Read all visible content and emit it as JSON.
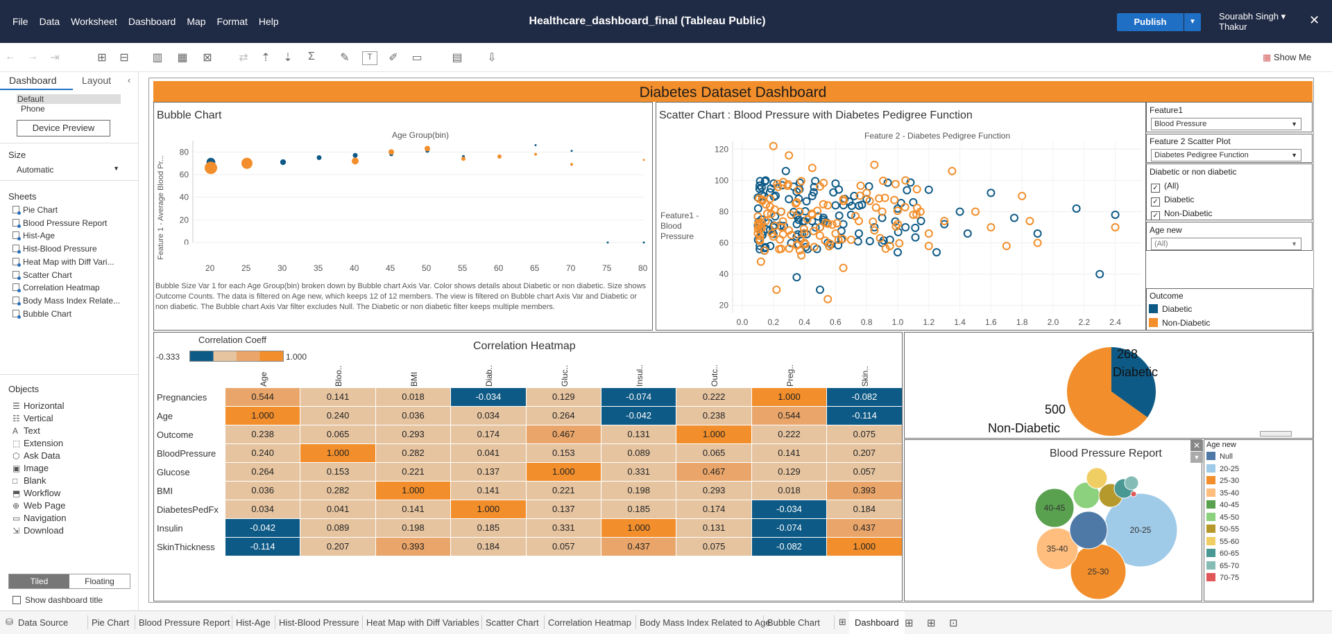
{
  "menu": [
    "File",
    "Data",
    "Worksheet",
    "Dashboard",
    "Map",
    "Format",
    "Help"
  ],
  "app_title": "Healthcare_dashboard_final (Tableau Public)",
  "publish_label": "Publish",
  "user_name_1": "Sourabh Singh",
  "user_name_2": "Thakur",
  "show_me": "Show Me",
  "left": {
    "tabs": [
      "Dashboard",
      "Layout"
    ],
    "device_default": "Default",
    "device_phone": "Phone",
    "device_preview": "Device Preview",
    "size_label": "Size",
    "size_value": "Automatic",
    "sheets_label": "Sheets",
    "sheets": [
      "Pie Chart",
      "Blood Pressure Report",
      "Hist-Age",
      "Hist-Blood Pressure",
      "Heat Map with Diff Vari...",
      "Scatter Chart",
      "Correlation Heatmap",
      "Body Mass Index Relate...",
      "Bubble Chart"
    ],
    "objects_label": "Objects",
    "objects": [
      {
        "label": "Horizontal",
        "icon": "horizontal-container-icon"
      },
      {
        "label": "Vertical",
        "icon": "vertical-container-icon"
      },
      {
        "label": "Text",
        "icon": "text-icon"
      },
      {
        "label": "Extension",
        "icon": "extension-icon"
      },
      {
        "label": "Ask Data",
        "icon": "ask-data-icon"
      },
      {
        "label": "Image",
        "icon": "image-icon"
      },
      {
        "label": "Blank",
        "icon": "blank-icon"
      },
      {
        "label": "Workflow",
        "icon": "workflow-icon"
      },
      {
        "label": "Web Page",
        "icon": "web-page-icon"
      },
      {
        "label": "Navigation",
        "icon": "navigation-icon"
      },
      {
        "label": "Download",
        "icon": "download-icon"
      }
    ],
    "tiled": "Tiled",
    "floating": "Floating",
    "show_title": "Show dashboard title"
  },
  "bottom_tabs": [
    "Data Source",
    "Pie Chart",
    "Blood Pressure Report",
    "Hist-Age",
    "Hist-Blood Pressure",
    "Heat Map with Diff Variables",
    "Scatter Chart",
    "Correlation Heatmap",
    "Body Mass Index Related to Age",
    "Bubble Chart",
    "Dashboard"
  ],
  "dashboard_title": "Diabetes Dataset Dashboard",
  "colors": {
    "diabetic": "#0e5a86",
    "non_diabetic": "#f28e2b"
  },
  "bubble": {
    "title": "Bubble Chart",
    "x_header": "Age Group(bin)",
    "y_title": "Feature 1 - Average Blood Pr...",
    "y_ticks": [
      "80",
      "60",
      "40",
      "20",
      "0"
    ],
    "x_ticks": [
      "20",
      "25",
      "30",
      "35",
      "40",
      "45",
      "50",
      "55",
      "60",
      "65",
      "70",
      "75",
      "80"
    ],
    "caption": "Bubble Size Var 1 for each Age Group(bin) broken down by Bubble chart Axis Var.  Color shows details about Diabetic or non diabetic.  Size shows Outcome Counts. The data is filtered on Age new, which keeps 12 of 12 members. The view is filtered on Bubble chart Axis Var and Diabetic or non diabetic. The Bubble chart Axis Var filter excludes Null. The Diabetic or non diabetic filter keeps multiple members."
  },
  "scatter": {
    "title": "Scatter Chart : Blood Pressure  with Diabetes Pedigree Function",
    "x_header": "Feature 2 - Diabetes Pedigree Function",
    "y_title_1": "Feature1 -",
    "y_title_2": "Blood",
    "y_title_3": "Pressure",
    "y_ticks": [
      "120",
      "100",
      "80",
      "60",
      "40",
      "20"
    ],
    "x_ticks": [
      "0.0",
      "0.2",
      "0.4",
      "0.6",
      "0.8",
      "1.0",
      "1.2",
      "1.4",
      "1.6",
      "1.8",
      "2.0",
      "2.2",
      "2.4"
    ]
  },
  "filters": {
    "f1_label": "Feature1",
    "f1_value": "Blood Pressure",
    "f2_label": "Feature 2 Scatter Plot",
    "f2_value": "Diabetes Pedigree Function",
    "dn_label": "Diabetic or non diabetic",
    "dn_options": [
      "(All)",
      "Diabetic",
      "Non-Diabetic"
    ],
    "age_label": "Age new",
    "age_value": "(All)",
    "outcome_label": "Outcome",
    "outcome_items": [
      "Diabetic",
      "Non-Diabetic"
    ]
  },
  "heatmap": {
    "title": "Correlation Heatmap",
    "legend_title": "Correlation Coeff",
    "legend_min": "-0.333",
    "legend_max": "1.000",
    "columns": [
      "Age",
      "Bloo..",
      "BMI",
      "Diab..",
      "Gluc..",
      "Insul..",
      "Outc..",
      "Preg..",
      "Skin.."
    ],
    "rows": [
      "Pregnancies",
      "Age",
      "Outcome",
      "BloodPressure",
      "Glucose",
      "BMI",
      "DiabetesPedFx",
      "Insulin",
      "SkinThickness"
    ],
    "values": [
      [
        "0.544",
        "0.141",
        "0.018",
        "-0.034",
        "0.129",
        "-0.074",
        "0.222",
        "1.000",
        "-0.082"
      ],
      [
        "1.000",
        "0.240",
        "0.036",
        "0.034",
        "0.264",
        "-0.042",
        "0.238",
        "0.544",
        "-0.114"
      ],
      [
        "0.238",
        "0.065",
        "0.293",
        "0.174",
        "0.467",
        "0.131",
        "1.000",
        "0.222",
        "0.075"
      ],
      [
        "0.240",
        "1.000",
        "0.282",
        "0.041",
        "0.153",
        "0.089",
        "0.065",
        "0.141",
        "0.207"
      ],
      [
        "0.264",
        "0.153",
        "0.221",
        "0.137",
        "1.000",
        "0.331",
        "0.467",
        "0.129",
        "0.057"
      ],
      [
        "0.036",
        "0.282",
        "1.000",
        "0.141",
        "0.221",
        "0.198",
        "0.293",
        "0.018",
        "0.393"
      ],
      [
        "0.034",
        "0.041",
        "0.141",
        "1.000",
        "0.137",
        "0.185",
        "0.174",
        "-0.034",
        "0.184"
      ],
      [
        "-0.042",
        "0.089",
        "0.198",
        "0.185",
        "0.331",
        "1.000",
        "0.131",
        "-0.074",
        "0.437"
      ],
      [
        "-0.114",
        "0.207",
        "0.393",
        "0.184",
        "0.057",
        "0.437",
        "0.075",
        "-0.082",
        "1.000"
      ]
    ]
  },
  "pie": {
    "diabetic_count": "268",
    "diabetic_label": "Diabetic",
    "non_count": "500",
    "non_label": "Non-Diabetic"
  },
  "bp_report": {
    "title": "Blood Pressure Report",
    "legend_title": "Age new",
    "legend": [
      {
        "label": "Null",
        "color": "#4e79a7"
      },
      {
        "label": "20-25",
        "color": "#a0cbe8"
      },
      {
        "label": "25-30",
        "color": "#f28e2b"
      },
      {
        "label": "35-40",
        "color": "#ffbe7d"
      },
      {
        "label": "40-45",
        "color": "#59a14f"
      },
      {
        "label": "45-50",
        "color": "#8cd17d"
      },
      {
        "label": "50-55",
        "color": "#b6992d"
      },
      {
        "label": "55-60",
        "color": "#f1ce63"
      },
      {
        "label": "60-65",
        "color": "#499894"
      },
      {
        "label": "65-70",
        "color": "#86bcb6"
      },
      {
        "label": "70-75",
        "color": "#e15759"
      }
    ],
    "bubbles": [
      {
        "label": "20-25",
        "color": "#a0cbe8"
      },
      {
        "label": "25-30",
        "color": "#f28e2b"
      },
      {
        "label": "35-40",
        "color": "#ffbe7d"
      },
      {
        "label": "40-45",
        "color": "#59a14f"
      },
      {
        "label": "",
        "color": "#4e79a7"
      },
      {
        "label": "",
        "color": "#8cd17d"
      },
      {
        "label": "",
        "color": "#b6992d"
      },
      {
        "label": "",
        "color": "#f1ce63"
      },
      {
        "label": "",
        "color": "#499894"
      },
      {
        "label": "",
        "color": "#86bcb6"
      },
      {
        "label": "",
        "color": "#e15759"
      }
    ]
  },
  "chart_data": [
    {
      "type": "scatter",
      "title": "Bubble Chart",
      "xlabel": "Age Group(bin)",
      "ylabel": "Feature 1 - Average Blood Pr...",
      "ylim": [
        0,
        90
      ],
      "x": [
        20,
        25,
        30,
        35,
        40,
        45,
        50,
        55,
        60,
        65,
        70,
        75,
        80
      ],
      "series": [
        {
          "name": "Diabetic",
          "values": [
            71,
            71,
            71,
            75,
            77,
            78,
            81,
            76,
            76,
            86,
            81,
            0,
            0
          ]
        },
        {
          "name": "Non-Diabetic",
          "values": [
            66,
            70,
            null,
            null,
            72,
            80,
            83,
            74,
            76,
            78,
            69,
            null,
            73
          ]
        }
      ]
    },
    {
      "type": "scatter",
      "title": "Scatter Chart : Blood Pressure  with Diabetes Pedigree Function",
      "xlabel": "Feature 2 - Diabetes Pedigree Function",
      "ylabel": "Feature1 - Blood Pressure",
      "xlim": [
        0,
        2.5
      ],
      "ylim": [
        20,
        125
      ],
      "series": [
        {
          "name": "Diabetic",
          "points": [
            [
              0.2,
              70
            ],
            [
              0.25,
              80
            ],
            [
              0.3,
              88
            ],
            [
              0.35,
              64
            ],
            [
              0.4,
              74
            ],
            [
              0.45,
              90
            ],
            [
              0.5,
              70
            ],
            [
              0.55,
              60
            ],
            [
              0.6,
              84
            ],
            [
              0.65,
              72
            ],
            [
              0.7,
              78
            ],
            [
              0.75,
              66
            ],
            [
              0.8,
              88
            ],
            [
              0.85,
              70
            ],
            [
              0.9,
              76
            ],
            [
              0.95,
              62
            ],
            [
              1.0,
              82
            ],
            [
              1.05,
              70
            ],
            [
              1.1,
              86
            ],
            [
              1.15,
              74
            ],
            [
              1.2,
              94
            ],
            [
              1.3,
              72
            ],
            [
              1.4,
              80
            ],
            [
              1.45,
              66
            ],
            [
              1.6,
              92
            ],
            [
              1.75,
              76
            ],
            [
              1.9,
              66
            ],
            [
              2.15,
              82
            ],
            [
              2.3,
              40
            ],
            [
              2.4,
              78
            ],
            [
              0.15,
              100
            ],
            [
              0.28,
              106
            ],
            [
              0.33,
              96
            ],
            [
              0.6,
              98
            ],
            [
              0.35,
              38
            ],
            [
              0.5,
              30
            ],
            [
              0.9,
              60
            ],
            [
              1.0,
              54
            ],
            [
              0.18,
              58
            ],
            [
              0.72,
              90
            ],
            [
              0.42,
              56
            ],
            [
              1.25,
              54
            ]
          ]
        },
        {
          "name": "Non-Diabetic",
          "points": [
            [
              0.15,
              74
            ],
            [
              0.2,
              64
            ],
            [
              0.25,
              80
            ],
            [
              0.3,
              68
            ],
            [
              0.35,
              86
            ],
            [
              0.4,
              60
            ],
            [
              0.45,
              78
            ],
            [
              0.5,
              70
            ],
            [
              0.55,
              84
            ],
            [
              0.6,
              66
            ],
            [
              0.65,
              88
            ],
            [
              0.7,
              62
            ],
            [
              0.75,
              74
            ],
            [
              0.8,
              92
            ],
            [
              0.85,
              68
            ],
            [
              0.9,
              80
            ],
            [
              0.95,
              58
            ],
            [
              1.0,
              72
            ],
            [
              1.1,
              78
            ],
            [
              1.2,
              66
            ],
            [
              1.3,
              74
            ],
            [
              1.5,
              80
            ],
            [
              1.6,
              70
            ],
            [
              1.7,
              58
            ],
            [
              1.8,
              90
            ],
            [
              1.85,
              74
            ],
            [
              1.9,
              60
            ],
            [
              2.4,
              70
            ],
            [
              0.2,
              122
            ],
            [
              0.3,
              116
            ],
            [
              0.22,
              30
            ],
            [
              0.55,
              24
            ],
            [
              0.12,
              48
            ],
            [
              0.45,
              108
            ],
            [
              0.85,
              110
            ],
            [
              1.05,
              100
            ],
            [
              1.35,
              106
            ],
            [
              0.65,
              44
            ],
            [
              0.38,
              52
            ],
            [
              1.2,
              58
            ]
          ]
        }
      ]
    },
    {
      "type": "pie",
      "categories": [
        "Diabetic",
        "Non-Diabetic"
      ],
      "values": [
        268,
        500
      ]
    },
    {
      "type": "heatmap",
      "title": "Correlation Heatmap",
      "legend_title": "Correlation Coeff",
      "range": [
        -0.333,
        1.0
      ]
    }
  ]
}
